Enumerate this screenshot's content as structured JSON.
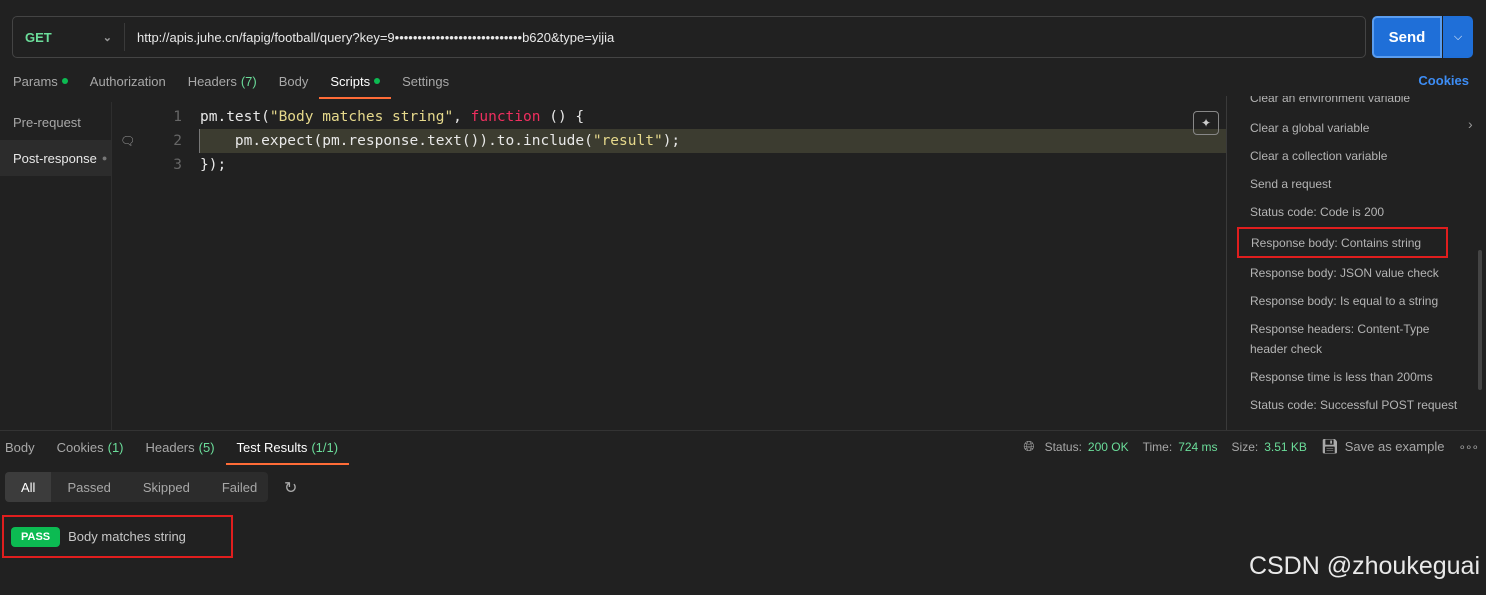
{
  "request": {
    "method": "GET",
    "url": "http://apis.juhe.cn/fapig/football/query?key=9••••••••••••••••••••••••••••b620&type=yijia",
    "send": "Send"
  },
  "req_tabs": [
    {
      "label": "Params",
      "dot": true
    },
    {
      "label": "Authorization"
    },
    {
      "label": "Headers",
      "count": "(7)"
    },
    {
      "label": "Body"
    },
    {
      "label": "Scripts",
      "dot": true,
      "active": true
    },
    {
      "label": "Settings"
    }
  ],
  "cookies": "Cookies",
  "script_tabs": [
    "Pre-request",
    "Post-response"
  ],
  "code": [
    {
      "n": "1",
      "tokens": [
        [
          "pm.test(",
          ""
        ],
        [
          "\"Body matches string\"",
          "str"
        ],
        [
          ", ",
          ""
        ],
        [
          "function",
          "kw"
        ],
        [
          " () {",
          ""
        ]
      ]
    },
    {
      "n": "2",
      "tokens": [
        [
          "    pm.expect(pm.response.text()).to.include(",
          ""
        ],
        [
          "\"result\"",
          "str"
        ],
        [
          ");",
          ""
        ]
      ]
    },
    {
      "n": "3",
      "tokens": [
        [
          "});",
          ""
        ]
      ]
    }
  ],
  "snippets": [
    "Clear an environment variable",
    "Clear a global variable",
    "Clear a collection variable",
    "Send a request",
    "Status code: Code is 200",
    "Response body: Contains string",
    "Response body: JSON value check",
    "Response body: Is equal to a string",
    "Response headers: Content-Type header check",
    "Response time is less than 200ms",
    "Status code: Successful POST request"
  ],
  "highlighted_snippet": "Response body: Contains string",
  "resp_tabs": [
    {
      "label": "Body"
    },
    {
      "label": "Cookies",
      "count": "(1)"
    },
    {
      "label": "Headers",
      "count": "(5)"
    },
    {
      "label": "Test Results",
      "count": "(1/1)",
      "active": true
    }
  ],
  "status": {
    "status_label": "Status:",
    "status": "200 OK",
    "time_label": "Time:",
    "time": "724 ms",
    "size_label": "Size:",
    "size": "3.51 KB",
    "save": "Save as example"
  },
  "filters": [
    "All",
    "Passed",
    "Skipped",
    "Failed"
  ],
  "result": {
    "badge": "PASS",
    "name": "Body matches string"
  },
  "watermark": "CSDN @zhoukeguai",
  "colors": {
    "accent": "#ff6c37",
    "send": "#1f6fd8",
    "pass": "#0cbb52",
    "highlight_box": "#e01e1e"
  }
}
